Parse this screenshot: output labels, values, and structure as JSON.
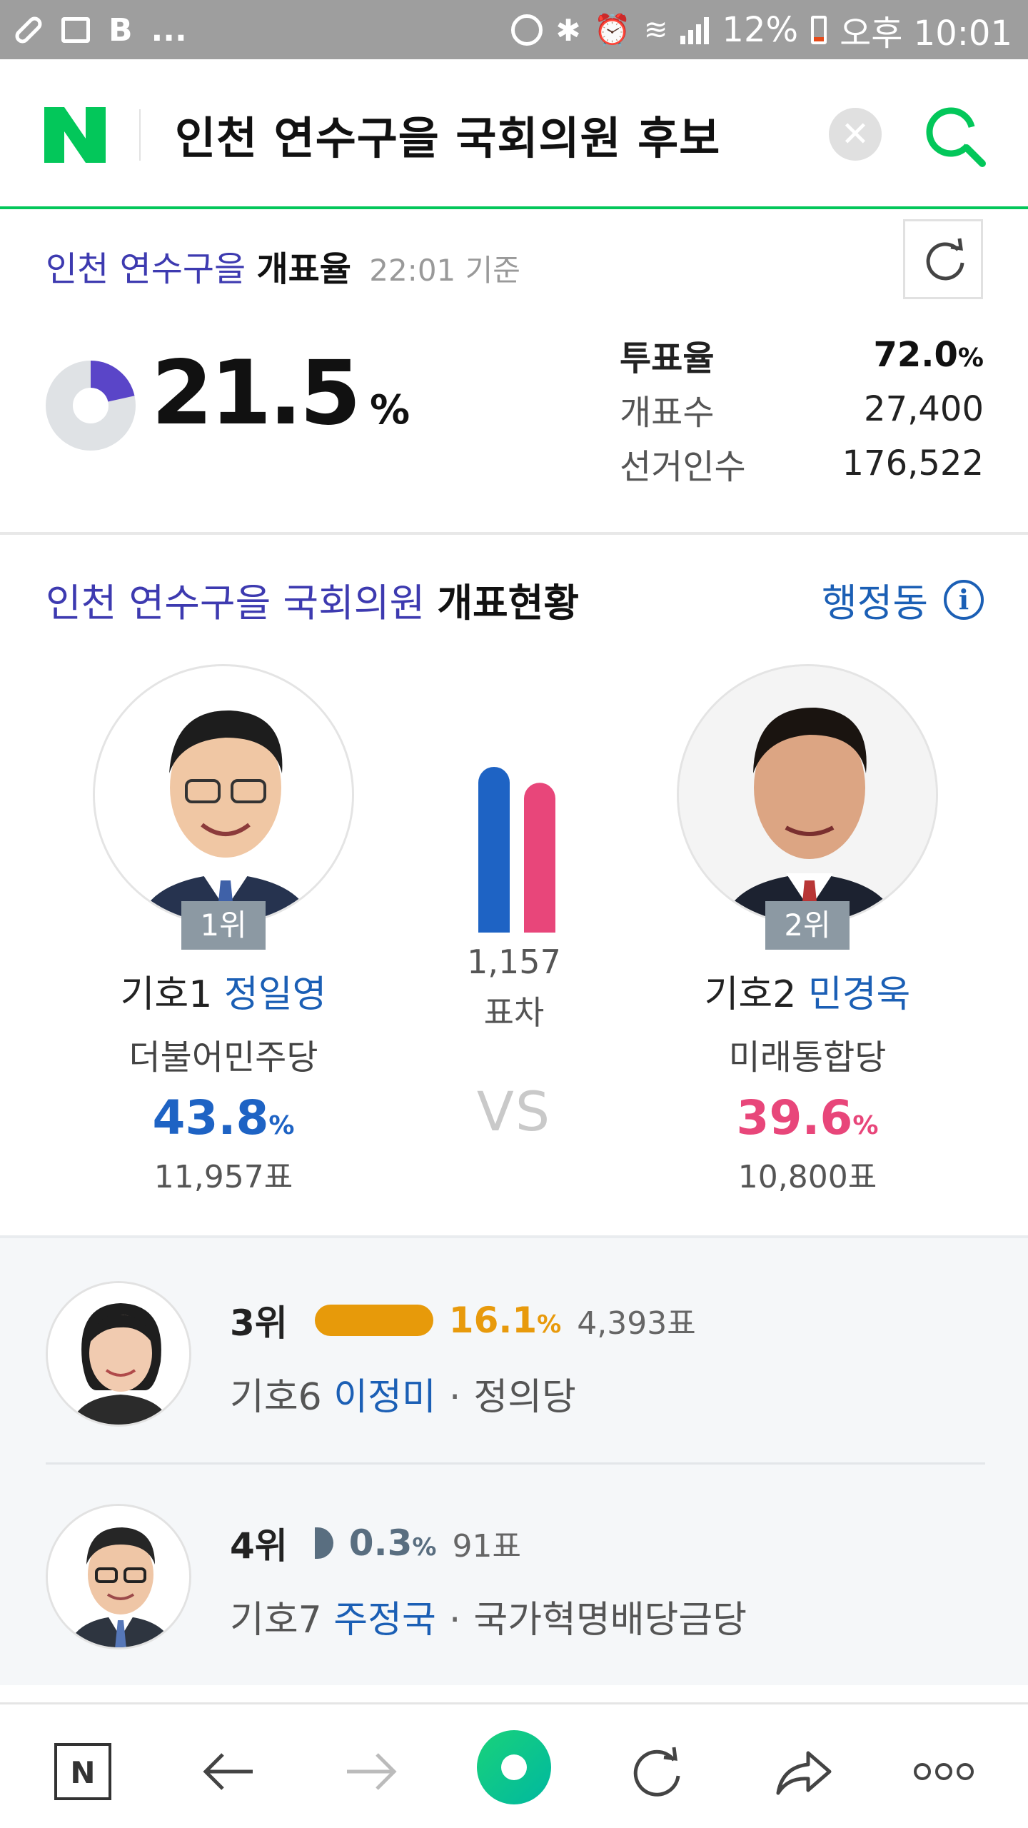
{
  "status_bar": {
    "bold_b": "B",
    "more": "...",
    "battery": "12%",
    "time": "오후 10:01"
  },
  "search": {
    "query": "인천 연수구을 국회의원 후보"
  },
  "turnout": {
    "title_region": "인천 연수구을",
    "title_label": "개표율",
    "time": "22:01 기준",
    "counted_rate": "21.5",
    "counted_rate_value": 21.5,
    "pct_sign": "%",
    "vote_rate_label": "투표율",
    "vote_rate_value": "72.0",
    "vote_rate_unit": "%",
    "counted_label": "개표수",
    "counted_value": "27,400",
    "electorate_label": "선거인수",
    "electorate_value": "176,522"
  },
  "status": {
    "title_region": "인천 연수구을 국회의원",
    "title_label": "개표현황",
    "link_label": "행정동",
    "gap_value": "1,157",
    "gap_label": "표차",
    "vs": "VS"
  },
  "candidates": [
    {
      "rank": "1위",
      "number": "기호1",
      "name": "정일영",
      "party": "더불어민주당",
      "pct": "43.8",
      "pct_value": 43.8,
      "pct_unit": "%",
      "votes": "11,957표",
      "color": "#1e63c4"
    },
    {
      "rank": "2위",
      "number": "기호2",
      "name": "민경욱",
      "party": "미래통합당",
      "pct": "39.6",
      "pct_value": 39.6,
      "pct_unit": "%",
      "votes": "10,800표",
      "color": "#e8467a"
    },
    {
      "rank": "3위",
      "number": "기호6",
      "name": "이정미",
      "party": "정의당",
      "pct": "16.1",
      "pct_value": 16.1,
      "pct_unit": "%",
      "votes": "4,393표",
      "color": "#e89a0c"
    },
    {
      "rank": "4위",
      "number": "기호7",
      "name": "주정국",
      "party": "국가혁명배당금당",
      "pct": "0.3",
      "pct_value": 0.3,
      "pct_unit": "%",
      "votes": "91표",
      "color": "#596e80"
    }
  ],
  "separator": "·",
  "colors": {
    "naver_green": "#03c75a",
    "region_blue": "#3d3ab0",
    "link_blue": "#1b5fb5"
  },
  "bottom_nav": {
    "home_letter": "N",
    "icons": [
      "naver-home-icon",
      "back-arrow-icon",
      "forward-arrow-icon",
      "green-dot-menu-icon",
      "reload-icon",
      "share-icon",
      "more-dots-icon"
    ]
  }
}
